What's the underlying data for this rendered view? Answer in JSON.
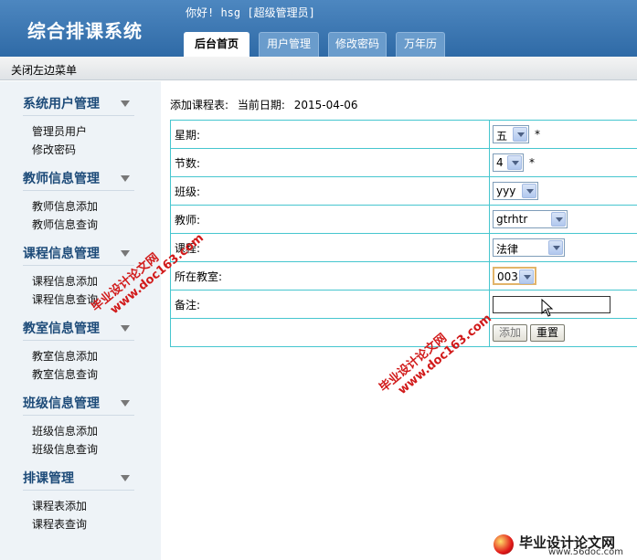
{
  "app": {
    "title": "综合排课系统",
    "greeting": "你好! hsg [超级管理员]"
  },
  "tabs": [
    {
      "label": "后台首页",
      "active": true
    },
    {
      "label": "用户管理"
    },
    {
      "label": "修改密码"
    },
    {
      "label": "万年历"
    }
  ],
  "toggle_menu": "关闭左边菜单",
  "sidebar": {
    "groups": [
      {
        "title": "系统用户管理",
        "items": [
          "管理员用户",
          "修改密码"
        ]
      },
      {
        "title": "教师信息管理",
        "items": [
          "教师信息添加",
          "教师信息查询"
        ]
      },
      {
        "title": "课程信息管理",
        "items": [
          "课程信息添加",
          "课程信息查询"
        ]
      },
      {
        "title": "教室信息管理",
        "items": [
          "教室信息添加",
          "教室信息查询"
        ]
      },
      {
        "title": "班级信息管理",
        "items": [
          "班级信息添加",
          "班级信息查询"
        ]
      },
      {
        "title": "排课管理",
        "items": [
          "课程表添加",
          "课程表查询"
        ]
      }
    ]
  },
  "main": {
    "heading": "添加课程表:",
    "date_label": "当前日期:",
    "date_value": "2015-04-06"
  },
  "form": {
    "weekday": {
      "label": "星期:",
      "value": "五",
      "required": "*"
    },
    "period": {
      "label": "节数:",
      "value": "4",
      "required": "*"
    },
    "class": {
      "label": "班级:",
      "value": "yyy"
    },
    "teacher": {
      "label": "教师:",
      "value": "gtrhtr"
    },
    "course": {
      "label": "课程:",
      "value": "法律"
    },
    "room": {
      "label": "所在教室:",
      "value": "003"
    },
    "remark": {
      "label": "备注:",
      "value": ""
    },
    "add_label": "添加",
    "reset_label": "重置"
  },
  "watermarks": {
    "text_cn": "毕业设计论文网",
    "text_url": "www.doc163.com",
    "corner_brand": "毕业设计论文网",
    "corner_url": "www.56doc.com"
  },
  "colors": {
    "header": "#2f6aa6",
    "sidebar_bg": "#eef3f7",
    "group_title": "#1d4b79",
    "table_border": "#46c6cf",
    "watermark": "#d11a1a"
  }
}
